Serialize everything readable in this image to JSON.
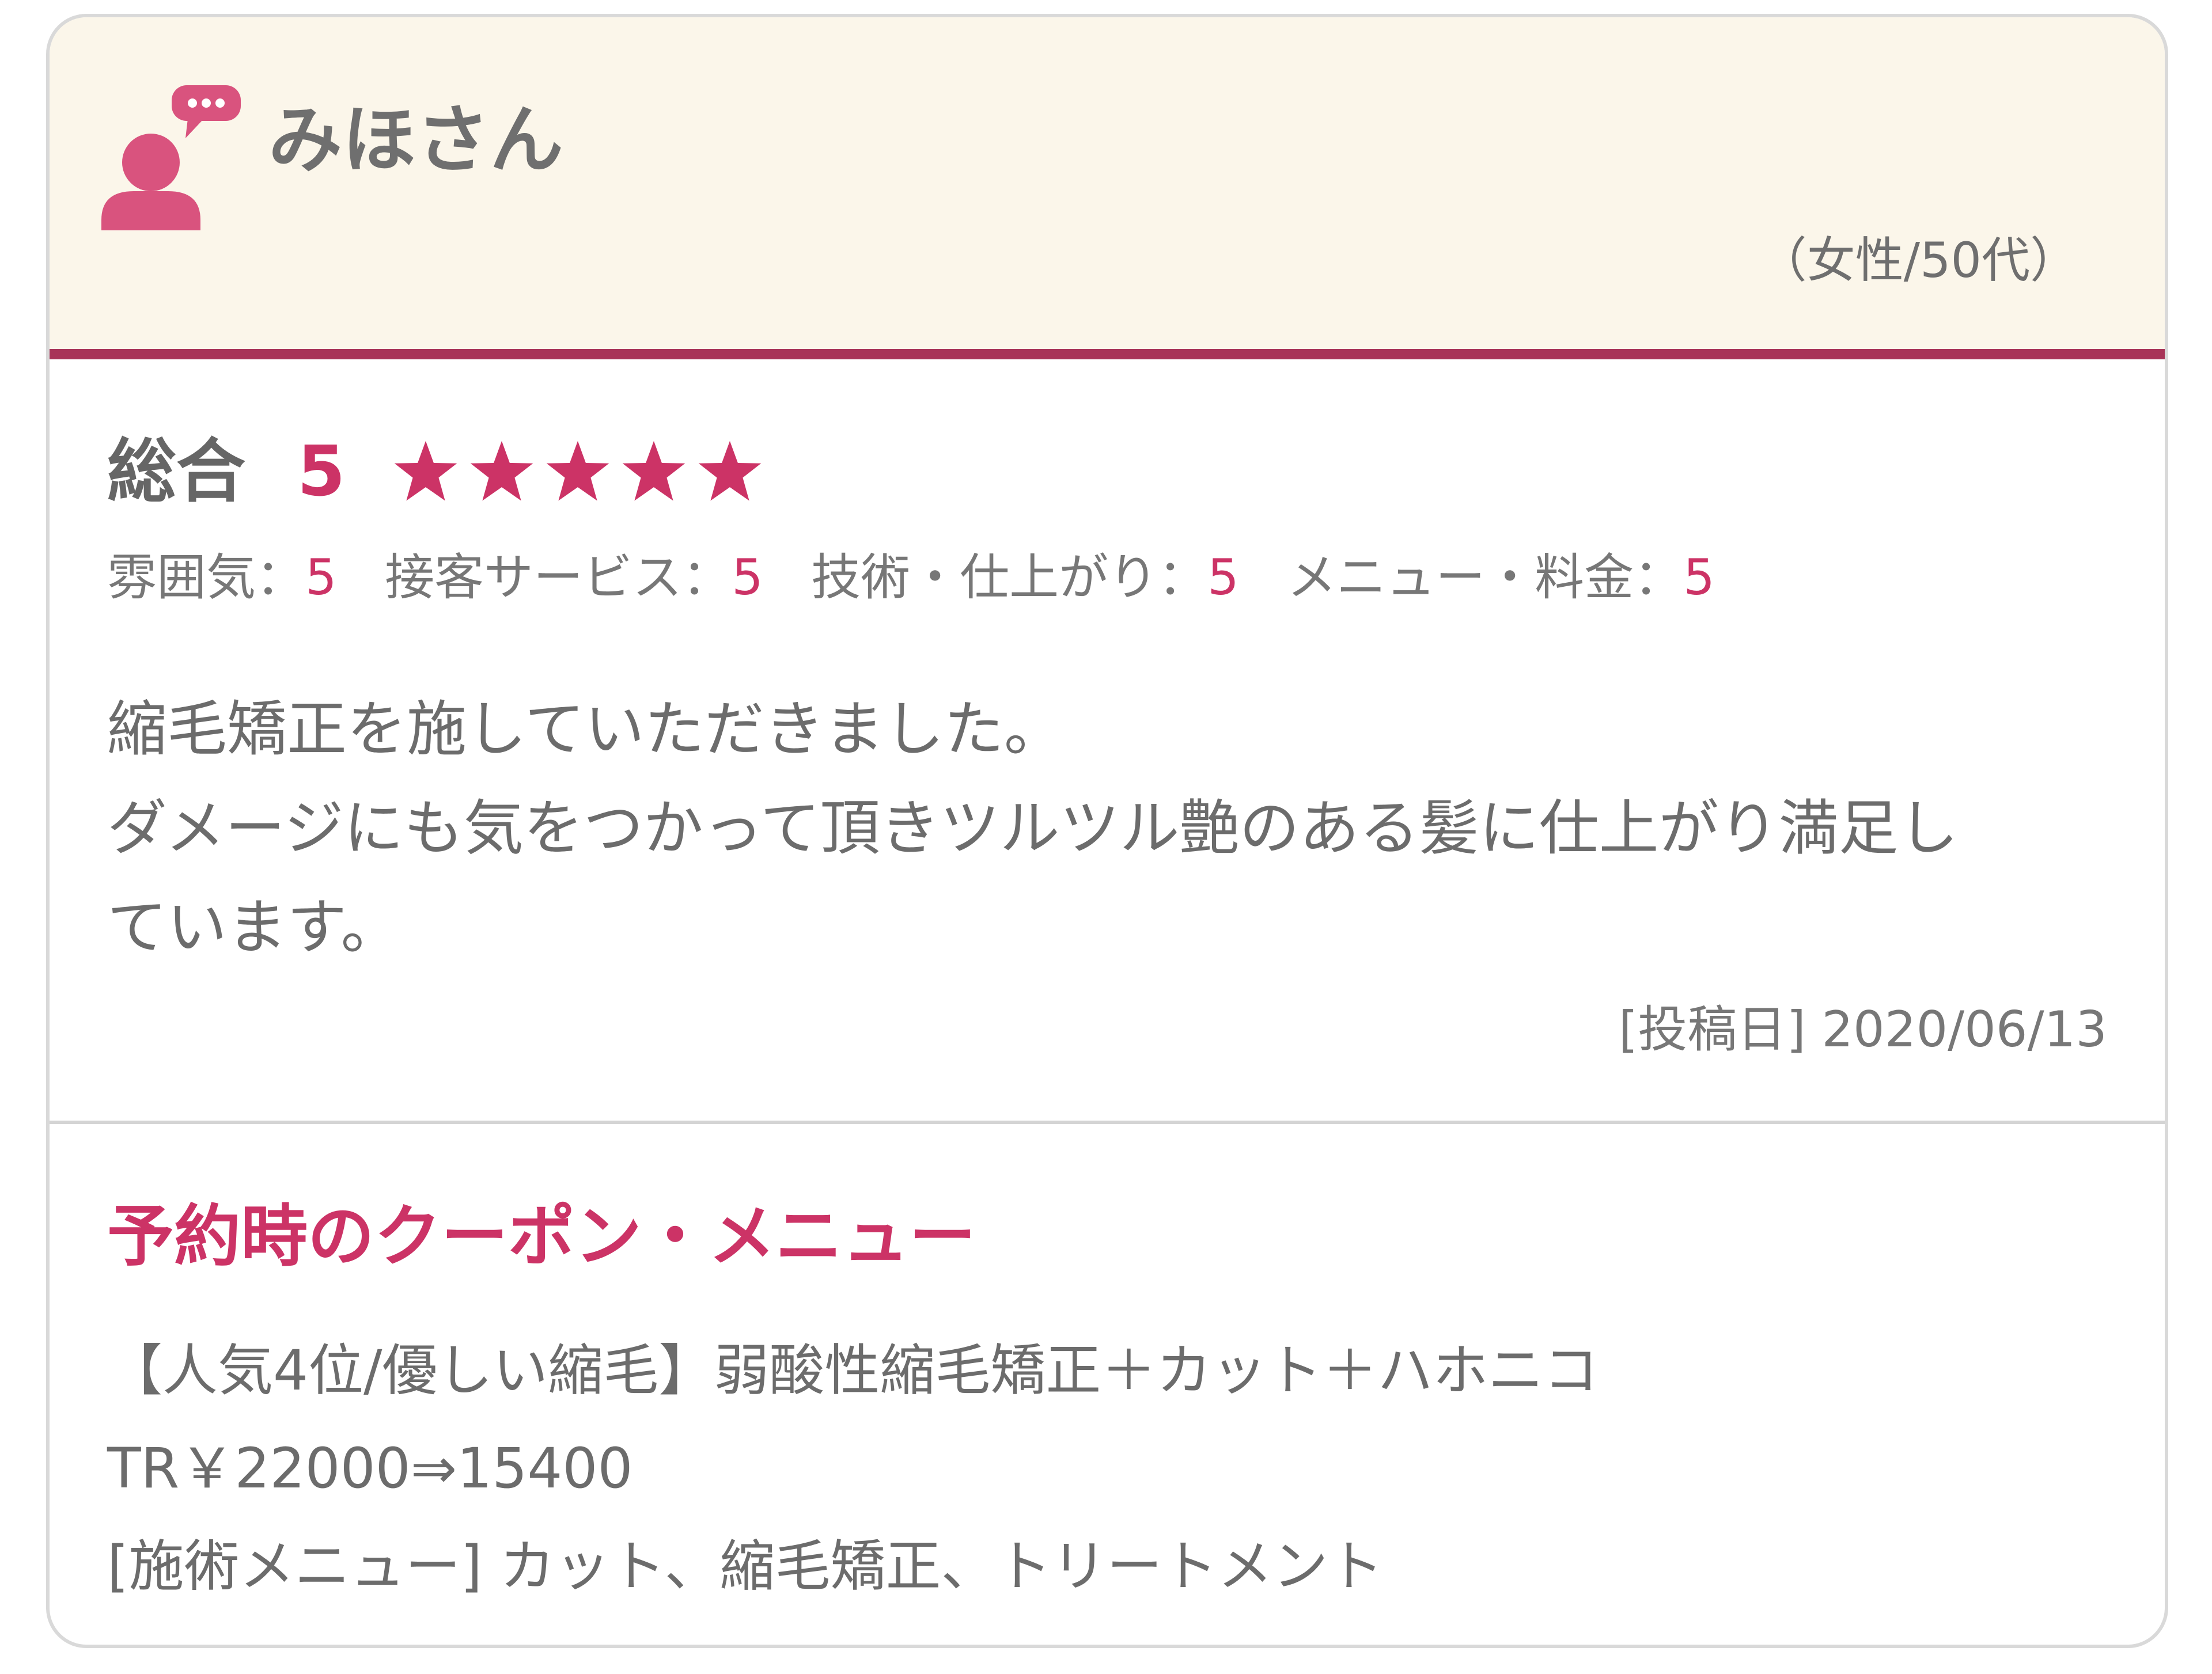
{
  "review": {
    "reviewer_name": "みほさん",
    "demographic": "（女性/50代）",
    "overall_label": "総合",
    "overall_score": "5",
    "overall_stars": 5,
    "subscores": [
      {
        "label": "雰囲気：",
        "value": "5"
      },
      {
        "label": "接客サービス：",
        "value": "5"
      },
      {
        "label": "技術・仕上がり：",
        "value": "5"
      },
      {
        "label": "メニュー・料金：",
        "value": "5"
      }
    ],
    "comment_lines": [
      "縮毛矯正を施していただきました。",
      "ダメージにも気をつかって頂きツルツル艶のある髪に仕上がり満足し",
      "ています。"
    ],
    "posted": "[投稿日] 2020/06/13"
  },
  "coupon": {
    "title": "予約時のクーポン・メニュー",
    "lines": [
      "【人気4位/優しい縮毛】弱酸性縮毛矯正＋カット＋ハホニコ",
      "TR￥22000⇒15400",
      "[施術メニュー] カット、縮毛矯正、トリートメント"
    ]
  },
  "icons": {
    "avatar": "user-speech-bubble-icon",
    "star": "star-icon"
  },
  "colors": {
    "accent": "#cc3366",
    "header_bg": "#fbf6ea",
    "header_rule": "#a83458",
    "avatar": "#d9537e",
    "text": "#6c6c6c"
  }
}
